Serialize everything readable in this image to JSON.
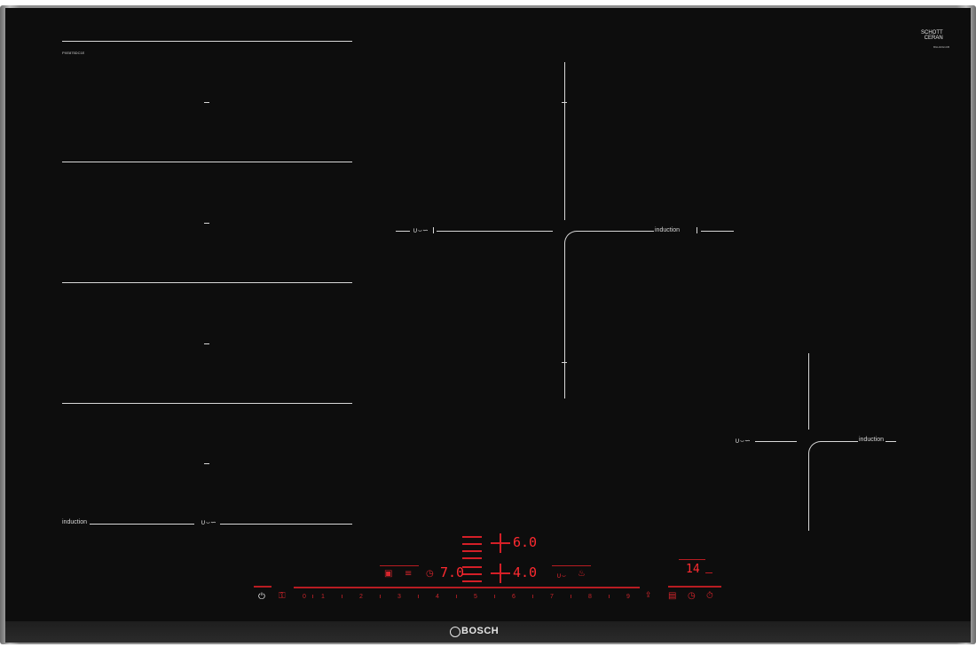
{
  "hob": {
    "model_label": "PXE875DC1E",
    "brand": "BOSCH",
    "glass_brand_line1": "SCHOTT",
    "glass_brand_line2": "CERAN",
    "glass_brand_sub": "BGH10G1CB",
    "zone_label": "induction"
  },
  "left_zone": {
    "label": "induction",
    "flex_symbol": "∪⌣∽"
  },
  "center_zone": {
    "label": "induction",
    "flex_symbol": "∪⌣∽"
  },
  "right_zone": {
    "label": "induction",
    "flex_symbol": "∪⌣∽"
  },
  "control_panel": {
    "display_upper": "6.0",
    "display_lower": "4.0",
    "display_left": "7.0",
    "timer_display": "14",
    "power_scale": [
      "0",
      "1",
      "2",
      "3",
      "4",
      "5",
      "6",
      "7",
      "8",
      "9"
    ],
    "power_icon": "power-icon",
    "childlock_icon": "child-lock-icon",
    "timer_icon": "timer-icon",
    "stopwatch_icon": "stopwatch-icon",
    "accent_color": "#e0202a"
  }
}
